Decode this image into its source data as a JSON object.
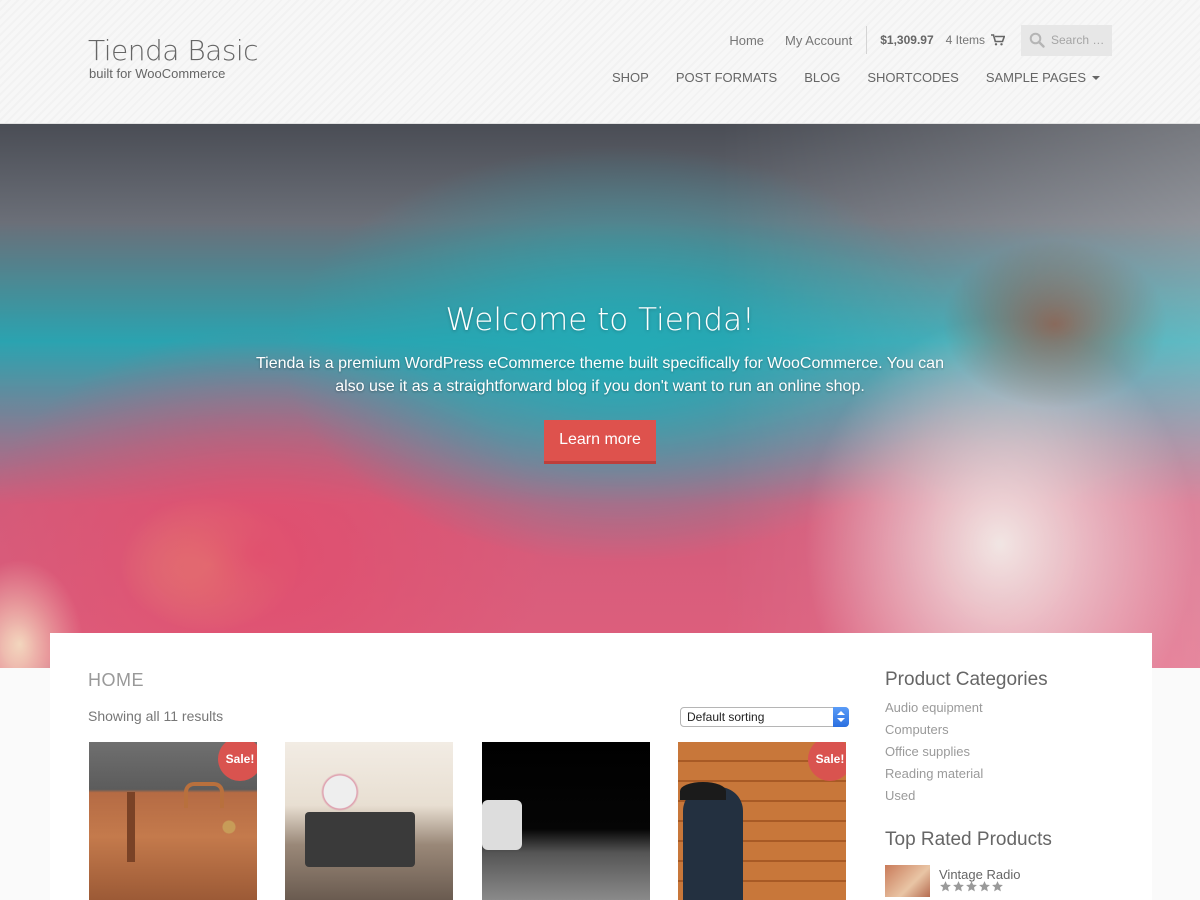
{
  "header": {
    "site_title": "Tienda Basic",
    "tagline": "built for WooCommerce",
    "top_links": {
      "home": "Home",
      "my_account": "My Account"
    },
    "cart": {
      "total": "$1,309.97",
      "items": "4 Items"
    },
    "search": {
      "placeholder": "Search …"
    },
    "nav": [
      {
        "label": "SHOP"
      },
      {
        "label": "POST FORMATS"
      },
      {
        "label": "BLOG"
      },
      {
        "label": "SHORTCODES"
      },
      {
        "label": "SAMPLE PAGES"
      }
    ]
  },
  "hero": {
    "title": "Welcome to Tienda!",
    "text": "Tienda is a premium WordPress eCommerce theme built specifically for WooCommerce. You can also use it as a straightforward blog if you don't want to run an online shop.",
    "button": "Learn more"
  },
  "main": {
    "breadcrumb": "HOME",
    "result_count": "Showing all 11 results",
    "sorting": {
      "selected": "Default sorting"
    },
    "products": [
      {
        "badge": "Sale!"
      },
      {
        "badge": ""
      },
      {
        "badge": ""
      },
      {
        "badge": "Sale!"
      }
    ]
  },
  "sidebar": {
    "categories_title": "Product Categories",
    "categories": [
      "Audio equipment",
      "Computers",
      "Office supplies",
      "Reading material",
      "Used"
    ],
    "top_rated_title": "Top Rated Products",
    "top_rated": [
      {
        "name": "Vintage Radio",
        "rating": 5
      }
    ]
  },
  "colors": {
    "accent": "#d9534f",
    "header_bg": "#f7f7f7",
    "star": "#9a9a9a"
  }
}
